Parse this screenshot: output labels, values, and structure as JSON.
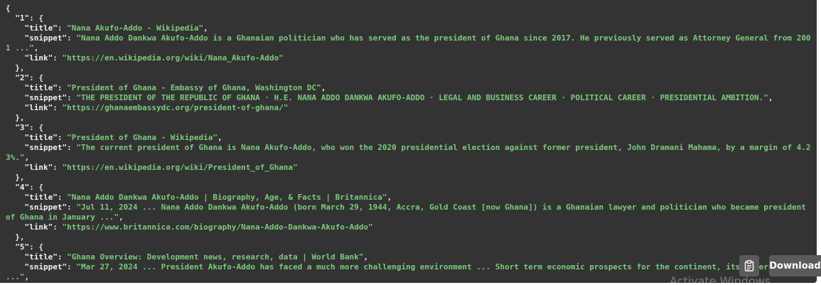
{
  "results": [
    {
      "key": "1",
      "title": "Nana Akufo-Addo - Wikipedia",
      "snippet": "Nana Addo Dankwa Akufo-Addo is a Ghanaian politician who has served as the president of Ghana since 2017. He previously served as Attorney General from 2001 ...",
      "link": "https://en.wikipedia.org/wiki/Nana_Akufo-Addo"
    },
    {
      "key": "2",
      "title": "President of Ghana - Embassy of Ghana, Washington DC",
      "snippet": "THE PRESIDENT OF THE REPUBLIC OF GHANA · H.E. NANA ADDO DANKWA AKUFO-ADDO · LEGAL AND BUSINESS CAREER · POLITICAL CAREER · PRESIDENTIAL AMBITION.",
      "link": "https://ghanaembassydc.org/president-of-ghana/"
    },
    {
      "key": "3",
      "title": "President of Ghana - Wikipedia",
      "snippet": "The current president of Ghana is Nana Akufo-Addo, who won the 2020 presidential election against former president, John Dramani Mahama, by a margin of 4.23%.",
      "link": "https://en.wikipedia.org/wiki/President_of_Ghana"
    },
    {
      "key": "4",
      "title": "Nana Addo Dankwa Akufo-Addo | Biography, Age, & Facts | Britannica",
      "snippet": "Jul 11, 2024 ... Nana Addo Dankwa Akufo-Addo (born March 29, 1944, Accra, Gold Coast [now Ghana]) is a Ghanaian lawyer and politician who became president of Ghana in January ...",
      "link": "https://www.britannica.com/biography/Nana-Addo-Dankwa-Akufo-Addo"
    },
    {
      "key": "5",
      "title": "Ghana Overview: Development news, research, data | World Bank",
      "snippet": "Mar 27, 2024 ... President Akufo-Addo has faced a much more challenging environment ... Short term economic prospects for the continent, its government ..."
    }
  ],
  "buttons": {
    "copy_icon": "clipboard-icon",
    "download_label": "Download"
  },
  "watermark": "Activate Windows"
}
